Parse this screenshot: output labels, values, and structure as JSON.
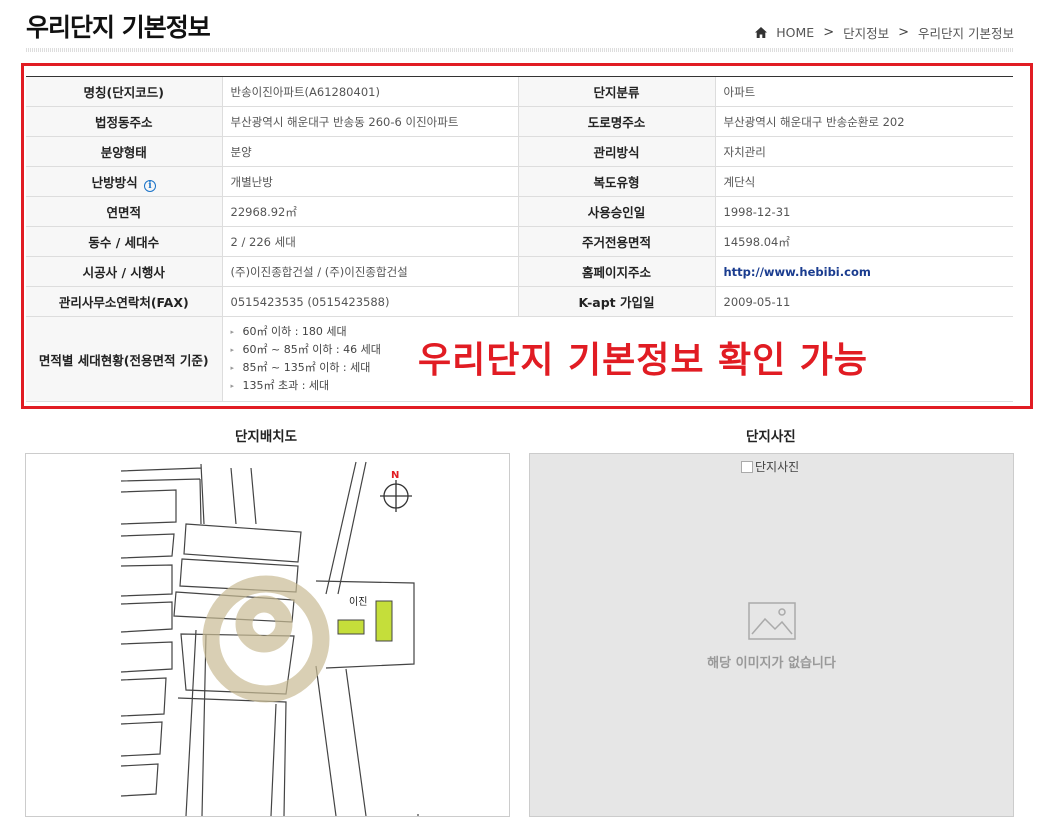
{
  "page": {
    "title": "우리단지 기본정보"
  },
  "breadcrumb": {
    "home": "HOME",
    "sep": ">",
    "level1": "단지정보",
    "level2": "우리단지 기본정보"
  },
  "info": {
    "rows": [
      {
        "l1": "명칭(단지코드)",
        "v1": "반송이진아파트(A61280401)",
        "l2": "단지분류",
        "v2": "아파트"
      },
      {
        "l1": "법정동주소",
        "v1": "부산광역시 해운대구 반송동 260-6 이진아파트",
        "l2": "도로명주소",
        "v2": "부산광역시 해운대구 반송순환로 202"
      },
      {
        "l1": "분양형태",
        "v1": "분양",
        "l2": "관리방식",
        "v2": "자치관리"
      },
      {
        "l1": "난방방식",
        "v1": "개별난방",
        "l2": "복도유형",
        "v2": "계단식"
      },
      {
        "l1": "연면적",
        "v1": "22968.92㎡",
        "l2": "사용승인일",
        "v2": "1998-12-31"
      },
      {
        "l1": "동수 / 세대수",
        "v1": "2 / 226 세대",
        "l2": "주거전용면적",
        "v2": "14598.04㎡"
      },
      {
        "l1": "시공사 / 시행사",
        "v1": "(주)이진종합건설 / (주)이진종합건설",
        "l2": "홈페이지주소",
        "v2": "http://www.hebibi.com"
      },
      {
        "l1": "관리사무소연락처(FAX)",
        "v1": "0515423535 (0515423588)",
        "l2": "K-apt 가입일",
        "v2": "2009-05-11"
      }
    ],
    "info_icon": "i",
    "size_label": "면적별 세대현황(전용면적 기준)",
    "sizes": [
      "60㎡ 이하 : 180 세대",
      "60㎡ ~ 85㎡ 이하 : 46 세대",
      "85㎡ ~ 135㎡ 이하 : 세대",
      "135㎡ 초과 : 세대"
    ]
  },
  "annotation": {
    "text": "우리단지 기본정보 확인 가능",
    "color": "#e11c23"
  },
  "layout_map": {
    "label": "단지배치도",
    "north": "N",
    "building_label": "이진"
  },
  "photo": {
    "label": "단지사진",
    "alt": "단지사진",
    "empty_text": "해당 이미지가 없습니다"
  }
}
